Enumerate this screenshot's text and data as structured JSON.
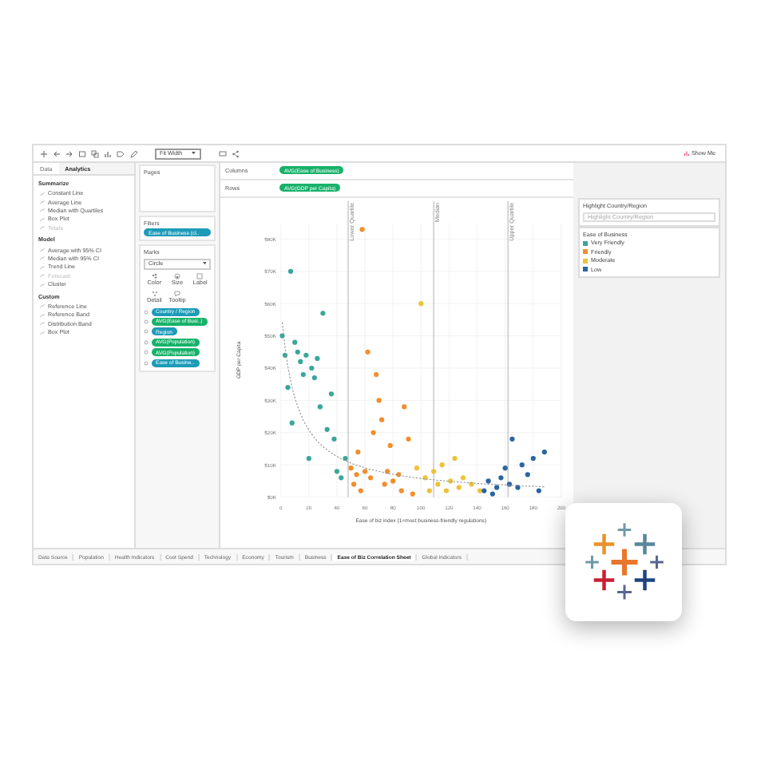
{
  "toolbar": {
    "fit": "Fit Width",
    "show_me": "Show Me"
  },
  "left_panel": {
    "tabs": [
      {
        "label": "Data",
        "selected": false
      },
      {
        "label": "Analytics",
        "selected": true
      }
    ],
    "sections": [
      {
        "title": "Summarize",
        "items": [
          {
            "label": "Constant Line",
            "disabled": false
          },
          {
            "label": "Average Line",
            "disabled": false
          },
          {
            "label": "Median with Quartiles",
            "disabled": false
          },
          {
            "label": "Box Plot",
            "disabled": false
          },
          {
            "label": "Totals",
            "disabled": true
          }
        ]
      },
      {
        "title": "Model",
        "items": [
          {
            "label": "Average with 95% CI",
            "disabled": false
          },
          {
            "label": "Median with 95% CI",
            "disabled": false
          },
          {
            "label": "Trend Line",
            "disabled": false
          },
          {
            "label": "Forecast",
            "disabled": true
          },
          {
            "label": "Cluster",
            "disabled": false
          }
        ]
      },
      {
        "title": "Custom",
        "items": [
          {
            "label": "Reference Line",
            "disabled": false
          },
          {
            "label": "Reference Band",
            "disabled": false
          },
          {
            "label": "Distribution Band",
            "disabled": false
          },
          {
            "label": "Box Plot",
            "disabled": false
          }
        ]
      }
    ]
  },
  "pages": {
    "title": "Pages"
  },
  "filters": {
    "title": "Filters",
    "pills": [
      {
        "label": "Ease of Business (cl..",
        "color": "#1d9bb8"
      }
    ]
  },
  "marks": {
    "title": "Marks",
    "type": "Circle",
    "buttons": [
      {
        "label": "Color",
        "kind": "color"
      },
      {
        "label": "Size",
        "kind": "size"
      },
      {
        "label": "Label",
        "kind": "label"
      },
      {
        "label": "Detail",
        "kind": "detail"
      },
      {
        "label": "Tooltip",
        "kind": "tooltip"
      }
    ],
    "pills": [
      {
        "label": "Country / Region",
        "color": "#1d9bb8"
      },
      {
        "label": "AVG(Ease of Busi..)",
        "color": "#17b26a"
      },
      {
        "label": "Region",
        "color": "#1d9bb8"
      },
      {
        "label": "AVG(Population)",
        "color": "#17b26a"
      },
      {
        "label": "AVG(Population)",
        "color": "#17b26a"
      },
      {
        "label": "Ease of Busine..",
        "color": "#1d9bb8"
      }
    ]
  },
  "shelves": [
    {
      "label": "Columns",
      "pill": "AVG(Ease of Business)"
    },
    {
      "label": "Rows",
      "pill": "AVG(GDP per Capita)"
    }
  ],
  "chart": {
    "chart_data": {
      "type": "scatter",
      "xlabel": "Ease of biz index (1=most business-friendly regulations)",
      "ylabel": "GDP per Capita",
      "xlim": [
        0,
        200
      ],
      "ylim": [
        0,
        85
      ],
      "grid": true,
      "xticks": [
        0,
        20,
        40,
        60,
        80,
        100,
        120,
        140,
        160,
        180,
        200
      ],
      "yticks": [
        {
          "value": 0,
          "label": "$0K"
        },
        {
          "value": 10,
          "label": "$10K"
        },
        {
          "value": 20,
          "label": "$20K"
        },
        {
          "value": 30,
          "label": "$30K"
        },
        {
          "value": 40,
          "label": "$40K"
        },
        {
          "value": 50,
          "label": "$50K"
        },
        {
          "value": 60,
          "label": "$60K"
        },
        {
          "value": 70,
          "label": "$70K"
        },
        {
          "value": 80,
          "label": "$80K"
        }
      ],
      "ref_lines": [
        {
          "axis": "x",
          "value": 48,
          "label": "Lower Quartile"
        },
        {
          "axis": "x",
          "value": 109,
          "label": "Median"
        },
        {
          "axis": "x",
          "value": 162,
          "label": "Upper Quartile"
        }
      ],
      "x": [
        1,
        3,
        5,
        7,
        8,
        10,
        12,
        14,
        16,
        18,
        20,
        22,
        24,
        26,
        28,
        30,
        33,
        36,
        38,
        40,
        43,
        46,
        50,
        52,
        54,
        55,
        57,
        58,
        60,
        62,
        64,
        66,
        68,
        70,
        72,
        74,
        76,
        78,
        80,
        84,
        86,
        88,
        91,
        94,
        97,
        100,
        103,
        106,
        109,
        112,
        115,
        118,
        121,
        124,
        127,
        130,
        136,
        142,
        145,
        148,
        151,
        154,
        157,
        160,
        163,
        165,
        169,
        172,
        176,
        180,
        184,
        188
      ],
      "series": [
        {
          "name": "Very Friendly",
          "color": "#3aa69b",
          "values": [
            50,
            44,
            34,
            70,
            23,
            48,
            45,
            42,
            38,
            44,
            12,
            40,
            37,
            43,
            28,
            57,
            21,
            32,
            18,
            8,
            6,
            12,
            null,
            null,
            null,
            null,
            null,
            null,
            null,
            null,
            null,
            null,
            null,
            null,
            null,
            null,
            null,
            null,
            null,
            null,
            null,
            null,
            null,
            null,
            null,
            null,
            null,
            null,
            null,
            null,
            null,
            null,
            null,
            null,
            null,
            null,
            null,
            null,
            null,
            null,
            null,
            null,
            null,
            null,
            null,
            null,
            null,
            null,
            null,
            null,
            null,
            null
          ]
        },
        {
          "name": "Friendly",
          "color": "#f28e2b",
          "values": [
            null,
            null,
            null,
            null,
            null,
            null,
            null,
            null,
            null,
            null,
            null,
            null,
            null,
            null,
            null,
            null,
            null,
            null,
            null,
            null,
            null,
            null,
            9,
            4,
            7,
            14,
            2,
            83,
            8,
            45,
            6,
            20,
            38,
            30,
            24,
            4,
            8,
            16,
            5,
            7,
            2,
            28,
            18,
            1,
            null,
            null,
            null,
            null,
            null,
            null,
            null,
            null,
            null,
            null,
            null,
            null,
            null,
            null,
            null,
            null,
            null,
            null,
            null,
            null,
            null,
            null,
            null,
            null,
            null,
            null,
            null,
            null
          ]
        },
        {
          "name": "Moderate",
          "color": "#edc23a",
          "values": [
            null,
            null,
            null,
            null,
            null,
            null,
            null,
            null,
            null,
            null,
            null,
            null,
            null,
            null,
            null,
            null,
            null,
            null,
            null,
            null,
            null,
            null,
            null,
            null,
            null,
            null,
            null,
            null,
            null,
            null,
            null,
            null,
            null,
            null,
            null,
            null,
            null,
            null,
            null,
            null,
            null,
            null,
            null,
            null,
            9,
            60,
            6,
            2,
            8,
            4,
            10,
            2,
            5,
            12,
            3,
            6,
            4,
            2,
            null,
            null,
            null,
            null,
            null,
            null,
            null,
            null,
            null,
            null,
            null,
            null,
            null,
            null
          ]
        },
        {
          "name": "Low",
          "color": "#2b65a0",
          "values": [
            null,
            null,
            null,
            null,
            null,
            null,
            null,
            null,
            null,
            null,
            null,
            null,
            null,
            null,
            null,
            null,
            null,
            null,
            null,
            null,
            null,
            null,
            null,
            null,
            null,
            null,
            null,
            null,
            null,
            null,
            null,
            null,
            null,
            null,
            null,
            null,
            null,
            null,
            null,
            null,
            null,
            null,
            null,
            null,
            null,
            null,
            null,
            null,
            null,
            null,
            null,
            null,
            null,
            null,
            null,
            null,
            null,
            null,
            2,
            5,
            1,
            3,
            6,
            9,
            4,
            18,
            3,
            10,
            7,
            12,
            2,
            14
          ]
        },
        {
          "type": "line",
          "line_style": "dashed",
          "color": "#999999",
          "values": [
            54.2,
            46.4,
            40.5,
            36.0,
            34.1,
            30.8,
            28.1,
            25.9,
            23.9,
            22.3,
            20.8,
            19.6,
            18.4,
            17.4,
            16.5,
            15.7,
            14.7,
            13.7,
            13.2,
            12.6,
            11.9,
            11.3,
            10.6,
            10.2,
            9.9,
            9.8,
            9.5,
            9.3,
            9.1,
            8.8,
            8.6,
            8.4,
            8.2,
            8.0,
            7.8,
            7.6,
            7.4,
            7.2,
            7.1,
            6.8,
            6.6,
            6.5,
            6.3,
            6.1,
            6.0,
            5.8,
            5.6,
            5.5,
            5.4,
            5.2,
            5.1,
            5.0,
            4.9,
            4.8,
            4.7,
            4.6,
            4.4,
            4.2,
            4.1,
            4.0,
            4.0,
            3.9,
            3.8,
            3.8,
            3.7,
            3.7,
            3.6,
            3.5,
            3.4,
            3.4,
            3.3,
            3.2
          ]
        }
      ]
    }
  },
  "right_panel": {
    "highlight": {
      "title": "Highlight Country/Region",
      "placeholder": "Highlight Country/Region"
    },
    "legend": {
      "title": "Ease of Business"
    }
  },
  "sheet_tabs": [
    {
      "label": "Data Source",
      "selected": false
    },
    {
      "label": "Population",
      "selected": false
    },
    {
      "label": "Health Indicators",
      "selected": false
    },
    {
      "label": "Cost Spend",
      "selected": false
    },
    {
      "label": "Technology",
      "selected": false
    },
    {
      "label": "Economy",
      "selected": false
    },
    {
      "label": "Tourism",
      "selected": false
    },
    {
      "label": "Business",
      "selected": false
    },
    {
      "label": "Ease of Biz Correlation Sheet",
      "selected": true
    },
    {
      "label": "Global Indicators",
      "selected": false
    }
  ]
}
